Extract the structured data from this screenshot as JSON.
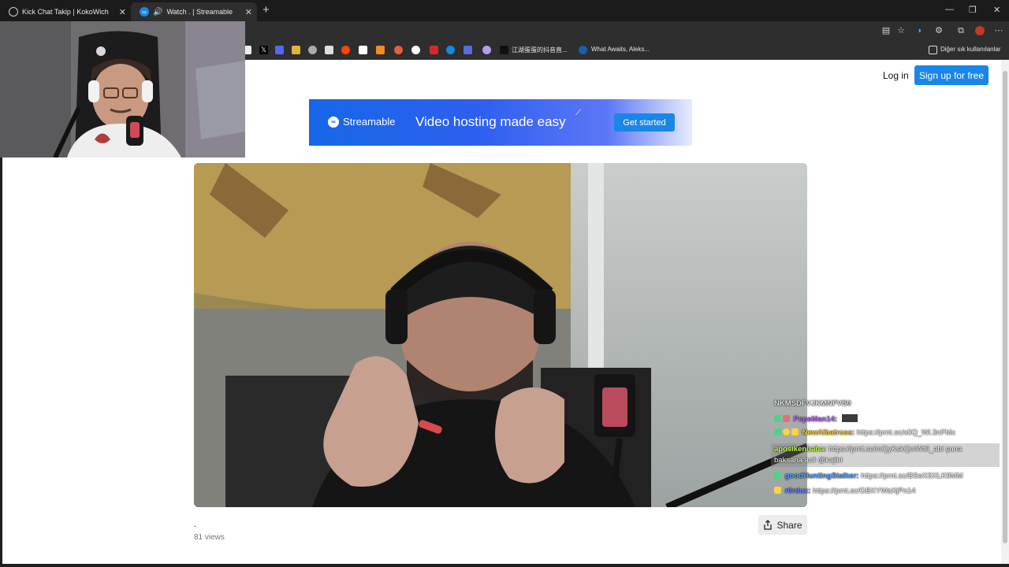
{
  "tabs": [
    {
      "title": "Kick Chat Takip | KokoWich",
      "active": false
    },
    {
      "title": "Watch . | Streamable",
      "active": true
    }
  ],
  "bookmarks": {
    "items": [
      "江湖蛋蛋的抖音直...",
      "What Awaits, Aleks..."
    ],
    "other_folder": "Diğer sık kullanılanlar"
  },
  "header": {
    "login": "Log in",
    "signup": "Sign up for free"
  },
  "banner": {
    "brand": "Streamable",
    "tagline": "Video hosting made easy",
    "cta": "Get started"
  },
  "video": {
    "title": ".",
    "views": "81 views",
    "share": "Share"
  },
  "chat": {
    "header": "NKMSDFVJKMNFVS0",
    "messages": [
      {
        "user": "PepeMan14:",
        "text": "",
        "color": "#b96bff",
        "badge": "#4fd18b"
      },
      {
        "user": "NewAlbatross:",
        "text": "https://prnt.sc/x0Q_Wl.3nFMx",
        "color": "#ffd23c",
        "badge": "#4fd18b"
      },
      {
        "user": "aposikenbaba:",
        "text": "https://prnt.sc/mQyKskQmWt0_abi şuna",
        "text2": "baksana acil @kajiiri",
        "color": "#c7ff4a",
        "badge": ""
      },
      {
        "user": "goodHuntingStalker:",
        "text": "https://prnt.sc/BSeXSXLK9MM",
        "color": "#5aa6ff",
        "badge": "#4fd18b"
      },
      {
        "user": "r0rdux:",
        "text": "https://prnt.sc/GBXYWaXjPn14",
        "color": "#6b8cff",
        "badge": "#ffd23c"
      }
    ]
  },
  "colors": {
    "accent": "#1a86e8",
    "browser_bg": "#2e2e2e"
  }
}
